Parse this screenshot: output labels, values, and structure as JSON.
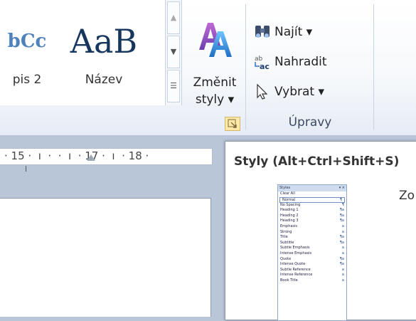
{
  "ribbon": {
    "gallery": {
      "items": [
        {
          "sample": "bCc",
          "label": "pis 2"
        },
        {
          "sample": "AaB",
          "label": "Název"
        }
      ]
    },
    "change_styles": {
      "line1": "Změnit",
      "line2": "styly ▾"
    },
    "edit_group": {
      "find": "Najít ▾",
      "replace": "Nahradit",
      "select": "Vybrat ▾",
      "label": "Úpravy"
    }
  },
  "ruler": {
    "text": "· 15 ·  ı  ·  ·  ı  · 17 ·  ı  · 18 ·"
  },
  "tooltip": {
    "title": "Styly (Alt+Ctrl+Shift+S)",
    "body_fragment": "Zo",
    "pane": {
      "header": "Styles",
      "close": "▾ ×",
      "rows": [
        {
          "label": "Clear All",
          "mark": ""
        },
        {
          "label": "Normal",
          "mark": "¶"
        },
        {
          "label": "No Spacing",
          "mark": "¶"
        },
        {
          "label": "Heading 1",
          "mark": "¶a"
        },
        {
          "label": "Heading 2",
          "mark": "¶a"
        },
        {
          "label": "Heading 3",
          "mark": "¶a"
        },
        {
          "label": "Emphasis",
          "mark": "a"
        },
        {
          "label": "Strong",
          "mark": "a"
        },
        {
          "label": "Title",
          "mark": "¶a"
        },
        {
          "label": "Subtitle",
          "mark": "¶a"
        },
        {
          "label": "Subtle Emphasis",
          "mark": "a"
        },
        {
          "label": "Intense Emphasis",
          "mark": "a"
        },
        {
          "label": "Quote",
          "mark": "¶a"
        },
        {
          "label": "Intense Quote",
          "mark": "¶a"
        },
        {
          "label": "Subtle Reference",
          "mark": "a"
        },
        {
          "label": "Intense Reference",
          "mark": "a"
        },
        {
          "label": "Book Title",
          "mark": "a"
        }
      ]
    }
  },
  "colors": {
    "accent": "#4f81bd",
    "title_style": "#17365d",
    "ribbon_border": "#b6c4d9"
  }
}
